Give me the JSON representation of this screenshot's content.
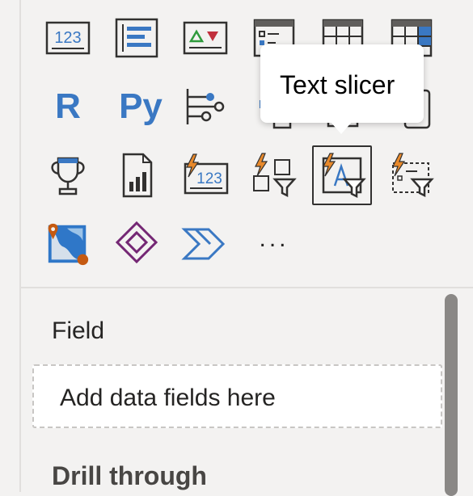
{
  "tooltip": {
    "text": "Text slicer"
  },
  "gallery": {
    "r_visual_label": "R",
    "python_visual_label": "Py",
    "more_label": "...",
    "card_label": "123",
    "new_card_label": "123"
  },
  "fields": {
    "section_label": "Field",
    "well_placeholder": "Add data fields here"
  },
  "drill_through": {
    "heading": "Drill through"
  },
  "colors": {
    "accent_blue": "#3a78c3",
    "preview_orange": "#e8892b",
    "power_apps_purple": "#742774",
    "icon_dark": "#323130",
    "background": "#f3f2f1"
  }
}
